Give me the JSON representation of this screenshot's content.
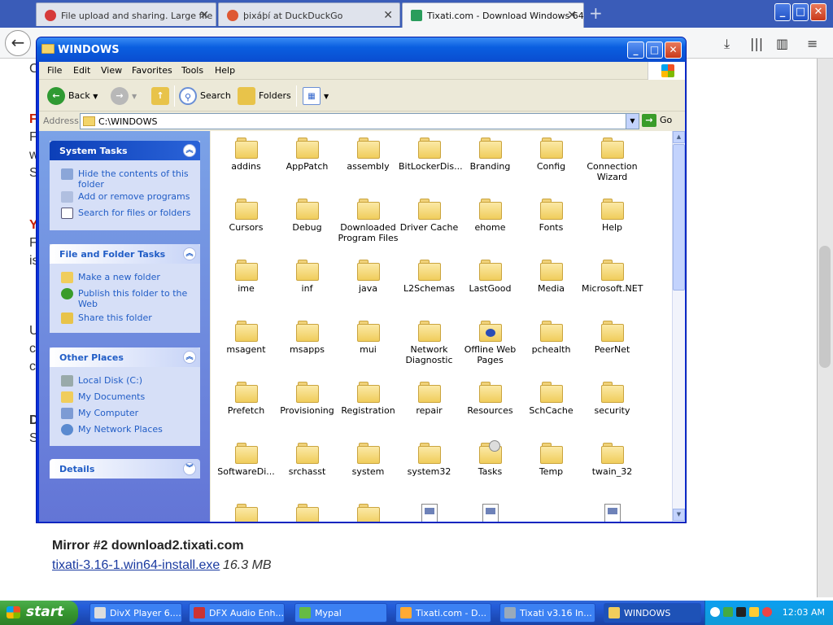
{
  "browser": {
    "tabs": [
      {
        "label": "File upload and sharing. Large file"
      },
      {
        "label": "þixáþí at DuckDuckGo"
      },
      {
        "label": "Tixati.com - Download Windows 64"
      }
    ]
  },
  "page": {
    "mirror_label": "Mirror #2  download2.tixati.com",
    "download_link": "tixati-3.16-1.win64-install.exe",
    "download_size": "16.3 MB",
    "left_fragments": [
      "C",
      "F",
      "F",
      "w",
      "S",
      "Y",
      "F",
      "is",
      "U",
      "c",
      "c",
      "D",
      "S"
    ]
  },
  "explorer": {
    "title": "WINDOWS",
    "menu": [
      "File",
      "Edit",
      "View",
      "Favorites",
      "Tools",
      "Help"
    ],
    "toolbar": {
      "back": "Back",
      "search": "Search",
      "folders": "Folders"
    },
    "address_label": "Address",
    "address_value": "C:\\WINDOWS",
    "go_label": "Go",
    "system_tasks": {
      "title": "System Tasks",
      "items": [
        "Hide the contents of this folder",
        "Add or remove programs",
        "Search for files or folders"
      ]
    },
    "file_folder_tasks": {
      "title": "File and Folder Tasks",
      "items": [
        "Make a new folder",
        "Publish this folder to the Web",
        "Share this folder"
      ]
    },
    "other_places": {
      "title": "Other Places",
      "items": [
        "Local Disk (C:)",
        "My Documents",
        "My Computer",
        "My Network Places"
      ]
    },
    "details": {
      "title": "Details"
    },
    "files": [
      [
        "addins",
        "AppPatch",
        "assembly",
        "BitLockerDis...",
        "Branding",
        "Config",
        "Connection Wizard"
      ],
      [
        "Cursors",
        "Debug",
        "Downloaded Program Files",
        "Driver Cache",
        "ehome",
        "Fonts",
        "Help"
      ],
      [
        "ime",
        "inf",
        "java",
        "L2Schemas",
        "LastGood",
        "Media",
        "Microsoft.NET"
      ],
      [
        "msagent",
        "msapps",
        "mui",
        "Network Diagnostic",
        "Offline Web Pages",
        "pchealth",
        "PeerNet"
      ],
      [
        "Prefetch",
        "Provisioning",
        "Registration",
        "repair",
        "Resources",
        "SchCache",
        "security"
      ],
      [
        "SoftwareDi...",
        "srchasst",
        "system",
        "system32",
        "Tasks",
        "Temp",
        "twain_32"
      ]
    ]
  },
  "taskbar": {
    "start": "start",
    "buttons": [
      "DivX Player 6....",
      "DFX Audio Enh...",
      "Mypal",
      "Tixati.com - D...",
      "Tixati v3.16 In...",
      "WINDOWS"
    ],
    "clock": "12:03 AM"
  }
}
